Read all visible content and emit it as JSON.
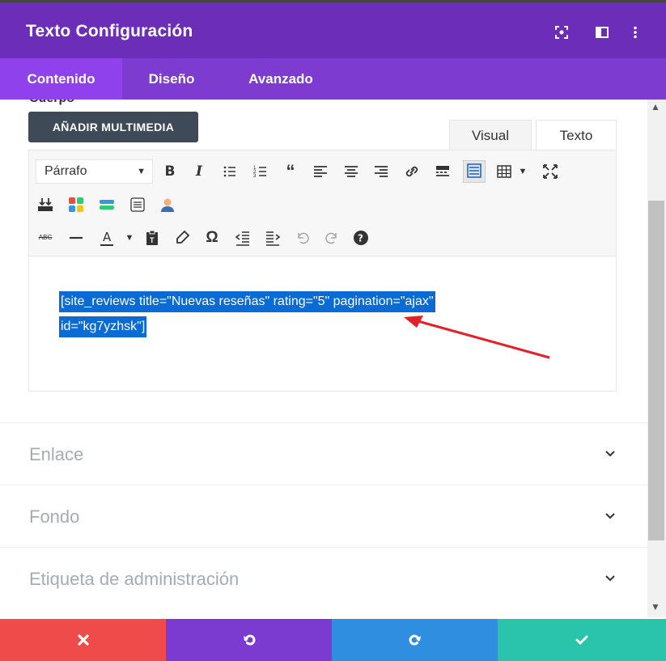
{
  "header": {
    "title": "Texto Configuración",
    "bg_color": "#6c2eb9",
    "icons": [
      "screenshot-icon",
      "split-view-icon",
      "more-vertical-icon"
    ]
  },
  "tabs": [
    {
      "label": "Contenido",
      "active": true
    },
    {
      "label": "Diseño",
      "active": false
    },
    {
      "label": "Avanzado",
      "active": false
    }
  ],
  "editor": {
    "section_label": "Cuerpo",
    "add_media_label": "AÑADIR MULTIMEDIA",
    "visual_tab": "Visual",
    "text_tab": "Texto",
    "format_select": "Párrafo",
    "content_line1": "[site_reviews title=\"Nuevas reseñas\" rating=\"5\" pagination=\"ajax\"",
    "content_line2": "id=\"kg7yzhsk\"]",
    "toolbar_row1": [
      "bold",
      "italic",
      "bullet-list",
      "numbered-list",
      "blockquote",
      "align-left",
      "align-center",
      "align-right",
      "link",
      "read-more",
      "toolbar-toggle",
      "table"
    ],
    "toolbar_row2": [
      "insert-above",
      "color-blocks",
      "horizontal-bar",
      "page-break",
      "user"
    ],
    "toolbar_row3": [
      "strikethrough",
      "horizontal-line",
      "text-color",
      "paste-text",
      "clear-formatting",
      "special-character",
      "outdent",
      "indent",
      "undo",
      "redo",
      "help"
    ]
  },
  "sections": [
    {
      "label": "Enlace"
    },
    {
      "label": "Fondo"
    },
    {
      "label": "Etiqueta de administración"
    }
  ],
  "footer": {
    "buttons": [
      {
        "name": "discard",
        "color": "#ef4b4b"
      },
      {
        "name": "undo",
        "color": "#7c3bd0"
      },
      {
        "name": "redo",
        "color": "#2f8ee0"
      },
      {
        "name": "save",
        "color": "#29c4a9"
      }
    ]
  },
  "colors": {
    "accent_purple": "#6c2eb9",
    "tab_bar": "#7e3bd0",
    "tab_active": "#8f42ec",
    "selection": "#0a6bd4",
    "annotation_arrow": "#e5202a"
  }
}
